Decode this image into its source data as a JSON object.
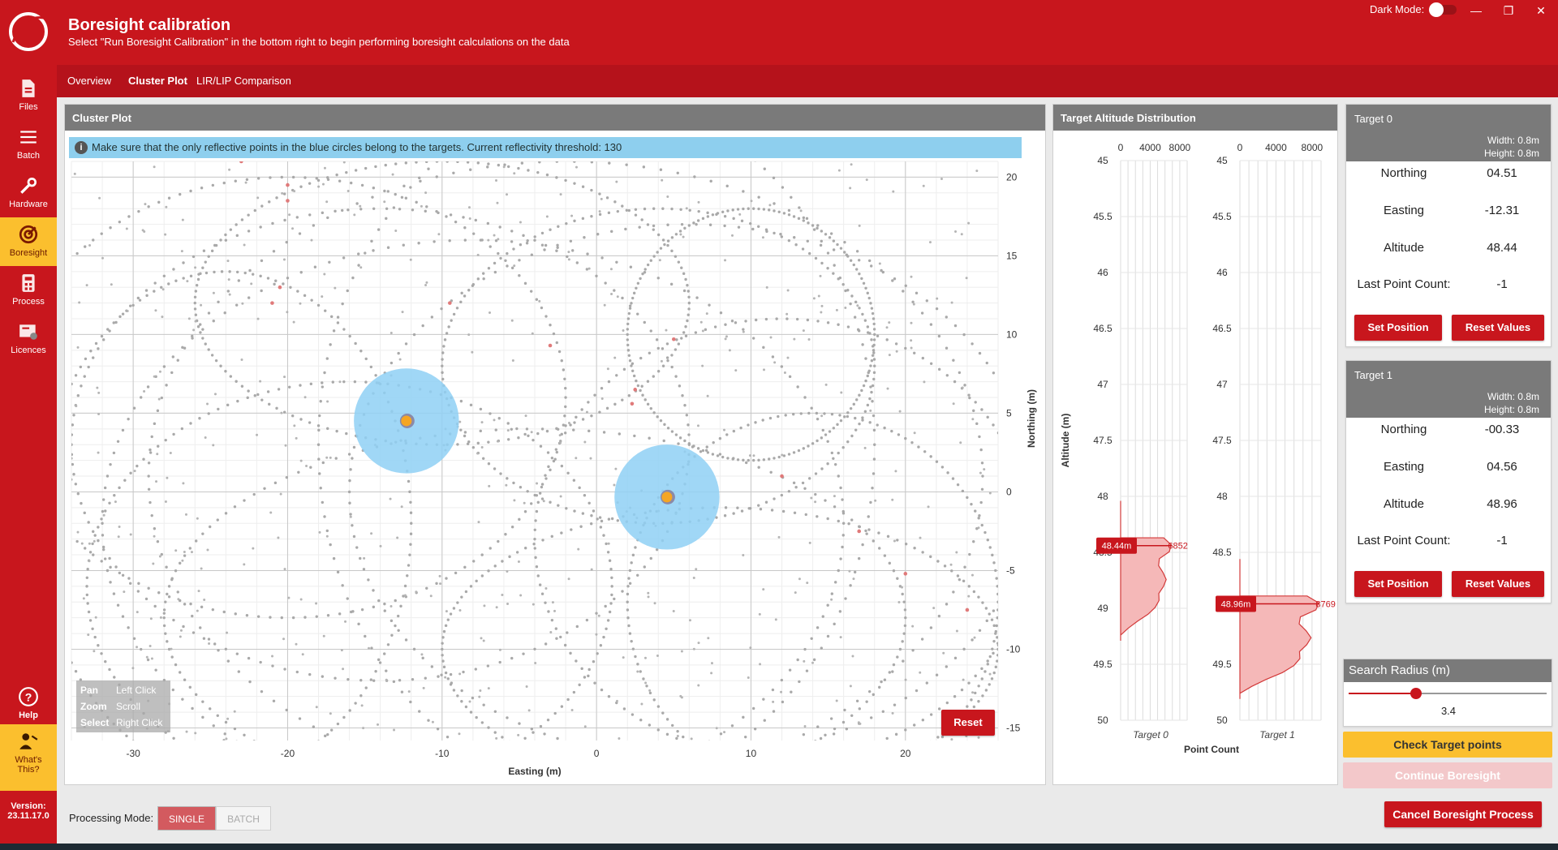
{
  "app": {
    "title": "Boresight calibration",
    "subtitle": "Select \"Run Boresight Calibration\" in the bottom right to begin performing boresight calculations on the data",
    "dark_mode_label": "Dark Mode:",
    "dark_mode_on": false,
    "version_label": "Version:",
    "version": "23.11.17.0"
  },
  "colors": {
    "brand_red": "#c8161d",
    "accent_yellow": "#fbbf2e",
    "info_blue": "#8ecfee"
  },
  "sidebar": {
    "items": [
      {
        "label": "Files",
        "icon": "file-icon"
      },
      {
        "label": "Batch",
        "icon": "list-icon"
      },
      {
        "label": "Hardware",
        "icon": "wrench-icon"
      },
      {
        "label": "Boresight",
        "icon": "target-icon",
        "active": true
      },
      {
        "label": "Process",
        "icon": "calculator-icon"
      },
      {
        "label": "Licences",
        "icon": "licence-icon"
      }
    ],
    "help_label": "Help",
    "whats_this_label": "What's This?"
  },
  "tabs": [
    {
      "label": "Overview"
    },
    {
      "label": "Cluster Plot",
      "active": true
    },
    {
      "label": "LIR/LIP Comparison"
    }
  ],
  "cluster_plot": {
    "title": "Cluster Plot",
    "info": "Make sure that the only reflective points in the blue circles belong to the targets. Current reflectivity threshold: 130",
    "xlabel": "Easting (m)",
    "ylabel": "Northing (m)",
    "xticks": [
      "-30",
      "-20",
      "-10",
      "0",
      "10",
      "20"
    ],
    "yticks": [
      "20",
      "15",
      "10",
      "5",
      "0",
      "-5",
      "-10",
      "-15"
    ],
    "legend": [
      {
        "key": "Pan",
        "value": "Left Click"
      },
      {
        "key": "Zoom",
        "value": "Scroll"
      },
      {
        "key": "Select",
        "value": "Right Click"
      }
    ],
    "reset_label": "Reset"
  },
  "chart_data": {
    "type": "scatter",
    "title": "Cluster Plot",
    "xlabel": "Easting (m)",
    "ylabel": "Northing (m)",
    "xlim": [
      -34,
      26
    ],
    "ylim": [
      -15.8,
      21
    ],
    "grid": true,
    "targets": [
      {
        "name": "Target 0",
        "easting": -12.31,
        "northing": 4.51,
        "radius": 3.4
      },
      {
        "name": "Target 1",
        "easting": 4.56,
        "northing": -0.33,
        "radius": 3.4
      }
    ]
  },
  "altitude": {
    "title": "Target Altitude Distribution",
    "ylabel": "Altitude (m)",
    "xlabel": "Point Count",
    "count_ticks": [
      "0",
      "4000",
      "8000"
    ],
    "alt_ticks": [
      "45",
      "45.5",
      "46",
      "46.5",
      "47",
      "47.5",
      "48",
      "48.5",
      "49",
      "49.5",
      "50"
    ],
    "histograms": [
      {
        "name": "Target 0",
        "peak_label": "48.44m",
        "peak_count": "6852",
        "peak_alt": 48.44,
        "peak_count_value": 6852
      },
      {
        "name": "Target 1",
        "peak_label": "48.96m",
        "peak_count": "8769",
        "peak_alt": 48.96,
        "peak_count_value": 8769
      }
    ]
  },
  "targets": [
    {
      "name": "Target 0",
      "width": "Width: 0.8m",
      "height": "Height: 0.8m",
      "rows": [
        {
          "label": "Northing",
          "value": "04.51"
        },
        {
          "label": "Easting",
          "value": "-12.31"
        },
        {
          "label": "Altitude",
          "value": "48.44"
        },
        {
          "label": "Last Point Count:",
          "value": "-1"
        }
      ],
      "set_label": "Set Position",
      "reset_label": "Reset Values"
    },
    {
      "name": "Target 1",
      "width": "Width: 0.8m",
      "height": "Height: 0.8m",
      "rows": [
        {
          "label": "Northing",
          "value": "-00.33"
        },
        {
          "label": "Easting",
          "value": "04.56"
        },
        {
          "label": "Altitude",
          "value": "48.96"
        },
        {
          "label": "Last Point Count:",
          "value": "-1"
        }
      ],
      "set_label": "Set Position",
      "reset_label": "Reset Values"
    }
  ],
  "search_radius": {
    "label": "Search Radius (m)",
    "value": "3.4",
    "fraction": 0.34
  },
  "actions": {
    "check_label": "Check Target points",
    "continue_label": "Continue Boresight",
    "cancel_label": "Cancel Boresight Process"
  },
  "processing": {
    "label": "Processing Mode:",
    "single": "SINGLE",
    "batch": "BATCH"
  }
}
